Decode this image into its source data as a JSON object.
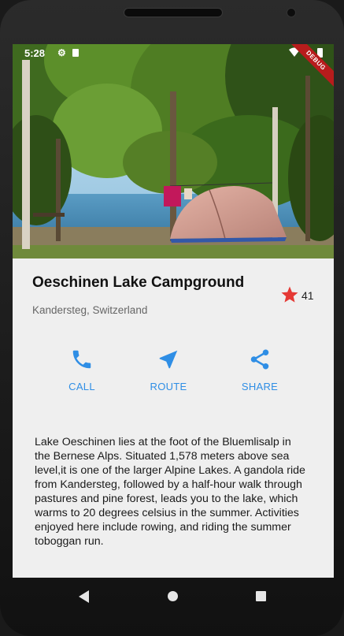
{
  "status_bar": {
    "time": "5:28",
    "icons": [
      "gear-icon",
      "sd-card-icon",
      "wifi-icon",
      "battery-icon"
    ],
    "debug_banner": "DEBUG"
  },
  "hero": {
    "image": "campsite-tent-lake-photo"
  },
  "place": {
    "title": "Oeschinen Lake Campground",
    "location": "Kandersteg, Switzerland",
    "rating_count": "41",
    "star_color": "#e53935"
  },
  "actions": [
    {
      "label": "CALL",
      "icon": "phone-icon"
    },
    {
      "label": "ROUTE",
      "icon": "navigation-icon"
    },
    {
      "label": "SHARE",
      "icon": "share-icon"
    }
  ],
  "accent_color": "#2f8ee5",
  "description": "Lake Oeschinen lies at the foot of the Bluemlisalp in the Bernese Alps. Situated 1,578 meters above sea level,it is one of the larger Alpine Lakes. A gandola ride from Kandersteg, followed by a half-hour walk through pastures and pine forest, leads you to the lake, which warms to 20 degrees celsius in the summer. Activities enjoyed here include rowing, and riding the summer toboggan run.",
  "nav": {
    "icons": [
      "back-icon",
      "home-icon",
      "recents-icon"
    ]
  }
}
